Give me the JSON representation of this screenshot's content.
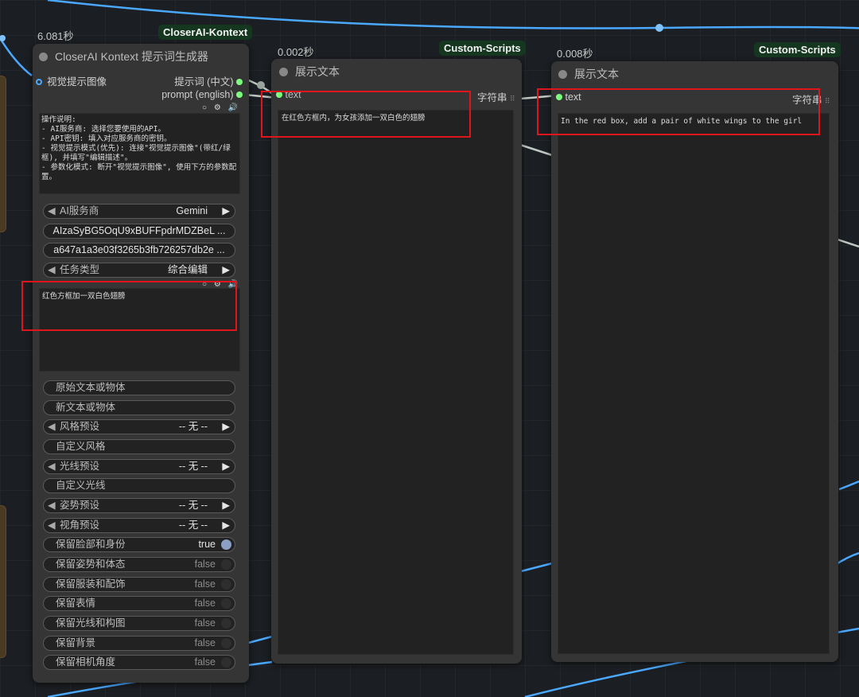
{
  "node1": {
    "time": "6.081秒",
    "badge": "CloserAI-Kontext",
    "title": "CloserAI Kontext 提示词生成器",
    "input_image": "视觉提示图像",
    "out1": "提示词 (中文)",
    "out2": "prompt (english)",
    "instructions": "操作说明:\n- AI服务商: 选择您要使用的API。\n- API密钥: 填入对应服务商的密钥。\n- 视觉提示模式(优先): 连接\"视觉提示图像\"(带红/绿框), 并填写\"编辑描述\"。\n- 参数化模式: 断开\"视觉提示图像\", 使用下方的参数配置。",
    "provider_label": "AI服务商",
    "provider_value": "Gemini",
    "api_key": "AIzaSyBG5OqU9xBUFFpdrMDZBeL ...",
    "api_secret": "a647a1a3e03f3265b3fb726257db2e ...",
    "task_label": "任务类型",
    "task_value": "综合编辑",
    "edit_text": "红色方框加一双白色翅膀",
    "f_orig": "原始文本或物体",
    "f_new": "新文本或物体",
    "style_label": "风格预设",
    "none": "-- 无 --",
    "custom_style": "自定义风格",
    "light_label": "光线预设",
    "custom_light": "自定义光线",
    "pose_label": "姿势预设",
    "view_label": "视角预设",
    "toggles": [
      {
        "label": "保留脸部和身份",
        "value": "true"
      },
      {
        "label": "保留姿势和体态",
        "value": "false"
      },
      {
        "label": "保留服装和配饰",
        "value": "false"
      },
      {
        "label": "保留表情",
        "value": "false"
      },
      {
        "label": "保留光线和构图",
        "value": "false"
      },
      {
        "label": "保留背景",
        "value": "false"
      },
      {
        "label": "保留相机角度",
        "value": "false"
      }
    ]
  },
  "node2": {
    "time": "0.002秒",
    "badge": "Custom-Scripts",
    "title": "展示文本",
    "input": "text",
    "output": "字符串",
    "text": "在红色方框内，为女孩添加一双白色的翅膀"
  },
  "node3": {
    "time": "0.008秒",
    "badge": "Custom-Scripts",
    "title": "展示文本",
    "input": "text",
    "output": "字符串",
    "text": "In the red box, add a pair of white wings to the girl"
  }
}
